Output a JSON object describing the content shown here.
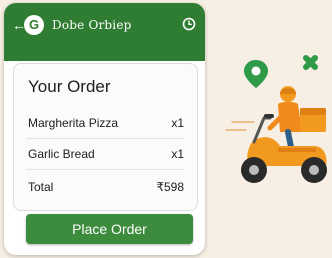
{
  "app": {
    "title": "Dobe Orbiep",
    "logo_letter": "G"
  },
  "icons": {
    "back": "back-arrow-icon",
    "brand": "brand-logo",
    "clock": "clock-icon",
    "scooter": "delivery-scooter-illustration"
  },
  "order": {
    "title": "Your Order",
    "items": [
      {
        "name": "Margherita Pizza",
        "qty": "x1"
      },
      {
        "name": "Garlic Bread",
        "qty": "x1"
      }
    ],
    "total_label": "Total",
    "total_value": "₹598"
  },
  "cta": {
    "label": "Place Order"
  },
  "colors": {
    "brand_green": "#2f7d32",
    "button_green": "#3d8b3d",
    "scooter_orange": "#f29a1f",
    "background": "#f7efe3"
  }
}
